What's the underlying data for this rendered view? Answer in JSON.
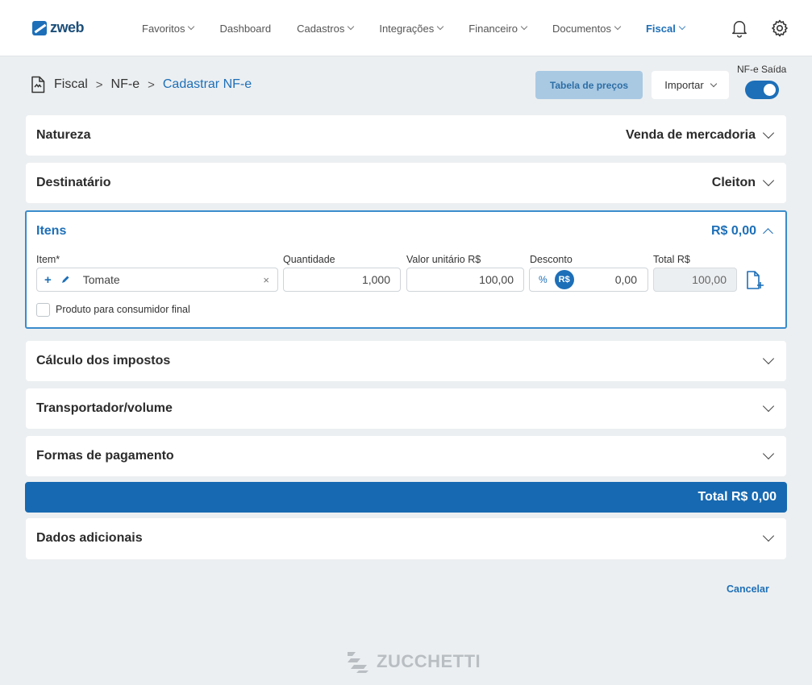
{
  "app": {
    "brand": "zweb"
  },
  "nav": [
    {
      "label": "Favoritos",
      "has_dropdown": true,
      "active": false
    },
    {
      "label": "Dashboard",
      "has_dropdown": false,
      "active": false
    },
    {
      "label": "Cadastros",
      "has_dropdown": true,
      "active": false
    },
    {
      "label": "Integrações",
      "has_dropdown": true,
      "active": false
    },
    {
      "label": "Financeiro",
      "has_dropdown": true,
      "active": false
    },
    {
      "label": "Documentos",
      "has_dropdown": true,
      "active": false
    },
    {
      "label": "Fiscal",
      "has_dropdown": true,
      "active": true
    }
  ],
  "breadcrumb": {
    "level1": "Fiscal",
    "level2": "NF-e",
    "current": "Cadastrar NF-e",
    "separator": ">"
  },
  "actions": {
    "tabela_label": "Tabela de preços",
    "importar_label": "Importar",
    "toggle_label": "NF-e Saída",
    "toggle_on": true
  },
  "sections": {
    "natureza": {
      "title": "Natureza",
      "value": "Venda de mercadoria"
    },
    "destinatario": {
      "title": "Destinatário",
      "value": "Cleiton"
    },
    "itens": {
      "title": "Itens",
      "value": "R$ 0,00",
      "labels": {
        "item": "Item*",
        "quantidade": "Quantidade",
        "valor_unitario": "Valor unitário R$",
        "desconto": "Desconto",
        "total": "Total R$"
      },
      "row": {
        "item": "Tomate",
        "quantidade": "1,000",
        "valor_unitario": "100,00",
        "desconto_percent_symbol": "%",
        "desconto_rs_symbol": "R$",
        "desconto": "0,00",
        "total": "100,00"
      },
      "consumidor_final_label": "Produto para consumidor final",
      "consumidor_final_checked": false
    },
    "calculo": {
      "title": "Cálculo dos impostos"
    },
    "transportador": {
      "title": "Transportador/volume"
    },
    "pagamento": {
      "title": "Formas de pagamento"
    },
    "adicionais": {
      "title": "Dados adicionais"
    }
  },
  "total_bar": "Total R$ 0,00",
  "cancel_label": "Cancelar",
  "footer": {
    "brand": "ZUCCHETTI"
  },
  "colors": {
    "primary": "#1d6fb8",
    "total_bar": "#1769b1",
    "tabela_button": "#a9c9e3",
    "background": "#eceff1"
  },
  "icons": [
    "bell-icon",
    "gear-icon",
    "document-icon",
    "plus-icon",
    "pencil-icon",
    "clear-icon",
    "add-document-icon",
    "chevron-down-icon",
    "chevron-up-icon"
  ]
}
